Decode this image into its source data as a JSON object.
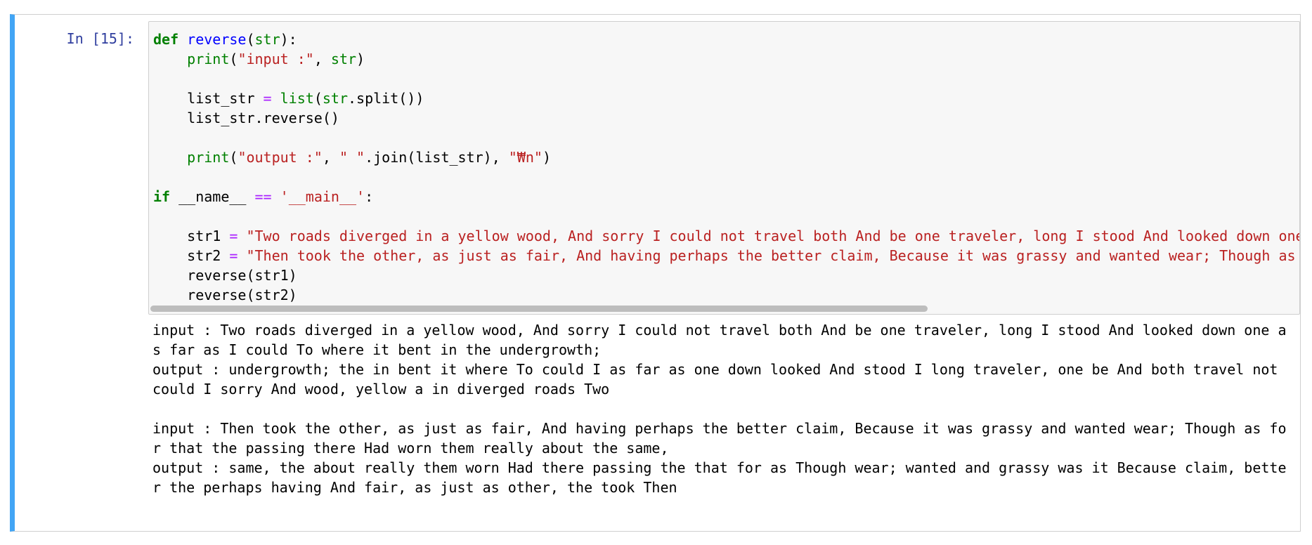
{
  "cell": {
    "prompt": "In [15]:",
    "code_lines": [
      [
        {
          "t": "def",
          "c": "kw"
        },
        {
          "t": " "
        },
        {
          "t": "reverse",
          "c": "fn"
        },
        {
          "t": "("
        },
        {
          "t": "str",
          "c": "bi"
        },
        {
          "t": "):"
        }
      ],
      [
        {
          "t": "    "
        },
        {
          "t": "print",
          "c": "bi"
        },
        {
          "t": "("
        },
        {
          "t": "\"input :\"",
          "c": "st"
        },
        {
          "t": ", "
        },
        {
          "t": "str",
          "c": "bi"
        },
        {
          "t": ")"
        }
      ],
      [
        {
          "t": ""
        }
      ],
      [
        {
          "t": "    list_str "
        },
        {
          "t": "=",
          "c": "op"
        },
        {
          "t": " "
        },
        {
          "t": "list",
          "c": "bi"
        },
        {
          "t": "("
        },
        {
          "t": "str",
          "c": "bi"
        },
        {
          "t": ".split())"
        }
      ],
      [
        {
          "t": "    list_str.reverse()"
        }
      ],
      [
        {
          "t": ""
        }
      ],
      [
        {
          "t": "    "
        },
        {
          "t": "print",
          "c": "bi"
        },
        {
          "t": "("
        },
        {
          "t": "\"output :\"",
          "c": "st"
        },
        {
          "t": ", "
        },
        {
          "t": "\" \"",
          "c": "st"
        },
        {
          "t": ".join(list_str), "
        },
        {
          "t": "\"₩n\"",
          "c": "st"
        },
        {
          "t": ")"
        }
      ],
      [
        {
          "t": ""
        }
      ],
      [
        {
          "t": "if",
          "c": "kw"
        },
        {
          "t": " __name__ "
        },
        {
          "t": "==",
          "c": "op"
        },
        {
          "t": " "
        },
        {
          "t": "'__main__'",
          "c": "st"
        },
        {
          "t": ":"
        }
      ],
      [
        {
          "t": ""
        }
      ],
      [
        {
          "t": "    str1 "
        },
        {
          "t": "=",
          "c": "op"
        },
        {
          "t": " "
        },
        {
          "t": "\"Two roads diverged in a yellow wood, And sorry I could not travel both And be one traveler, long I stood And looked down one",
          "c": "st"
        }
      ],
      [
        {
          "t": "    str2 "
        },
        {
          "t": "=",
          "c": "op"
        },
        {
          "t": " "
        },
        {
          "t": "\"Then took the other, as just as fair, And having perhaps the better claim, Because it was grassy and wanted wear; Though as",
          "c": "st"
        }
      ],
      [
        {
          "t": "    reverse(str1)"
        }
      ],
      [
        {
          "t": "    reverse(str2)"
        }
      ]
    ],
    "output_lines": [
      "input : Two roads diverged in a yellow wood, And sorry I could not travel both And be one traveler, long I stood And looked down one a",
      "s far as I could To where it bent in the undergrowth;",
      "output : undergrowth; the in bent it where To could I as far as one down looked And stood I long traveler, one be And both travel not",
      "could I sorry And wood, yellow a in diverged roads Two",
      "",
      "input : Then took the other, as just as fair, And having perhaps the better claim, Because it was grassy and wanted wear; Though as fo",
      "r that the passing there Had worn them really about the same,",
      "output : same, the about really them worn Had there passing the that for as Though wear; wanted and grassy was it Because claim, bette",
      "r the perhaps having And fair, as just as other, the took Then"
    ]
  }
}
